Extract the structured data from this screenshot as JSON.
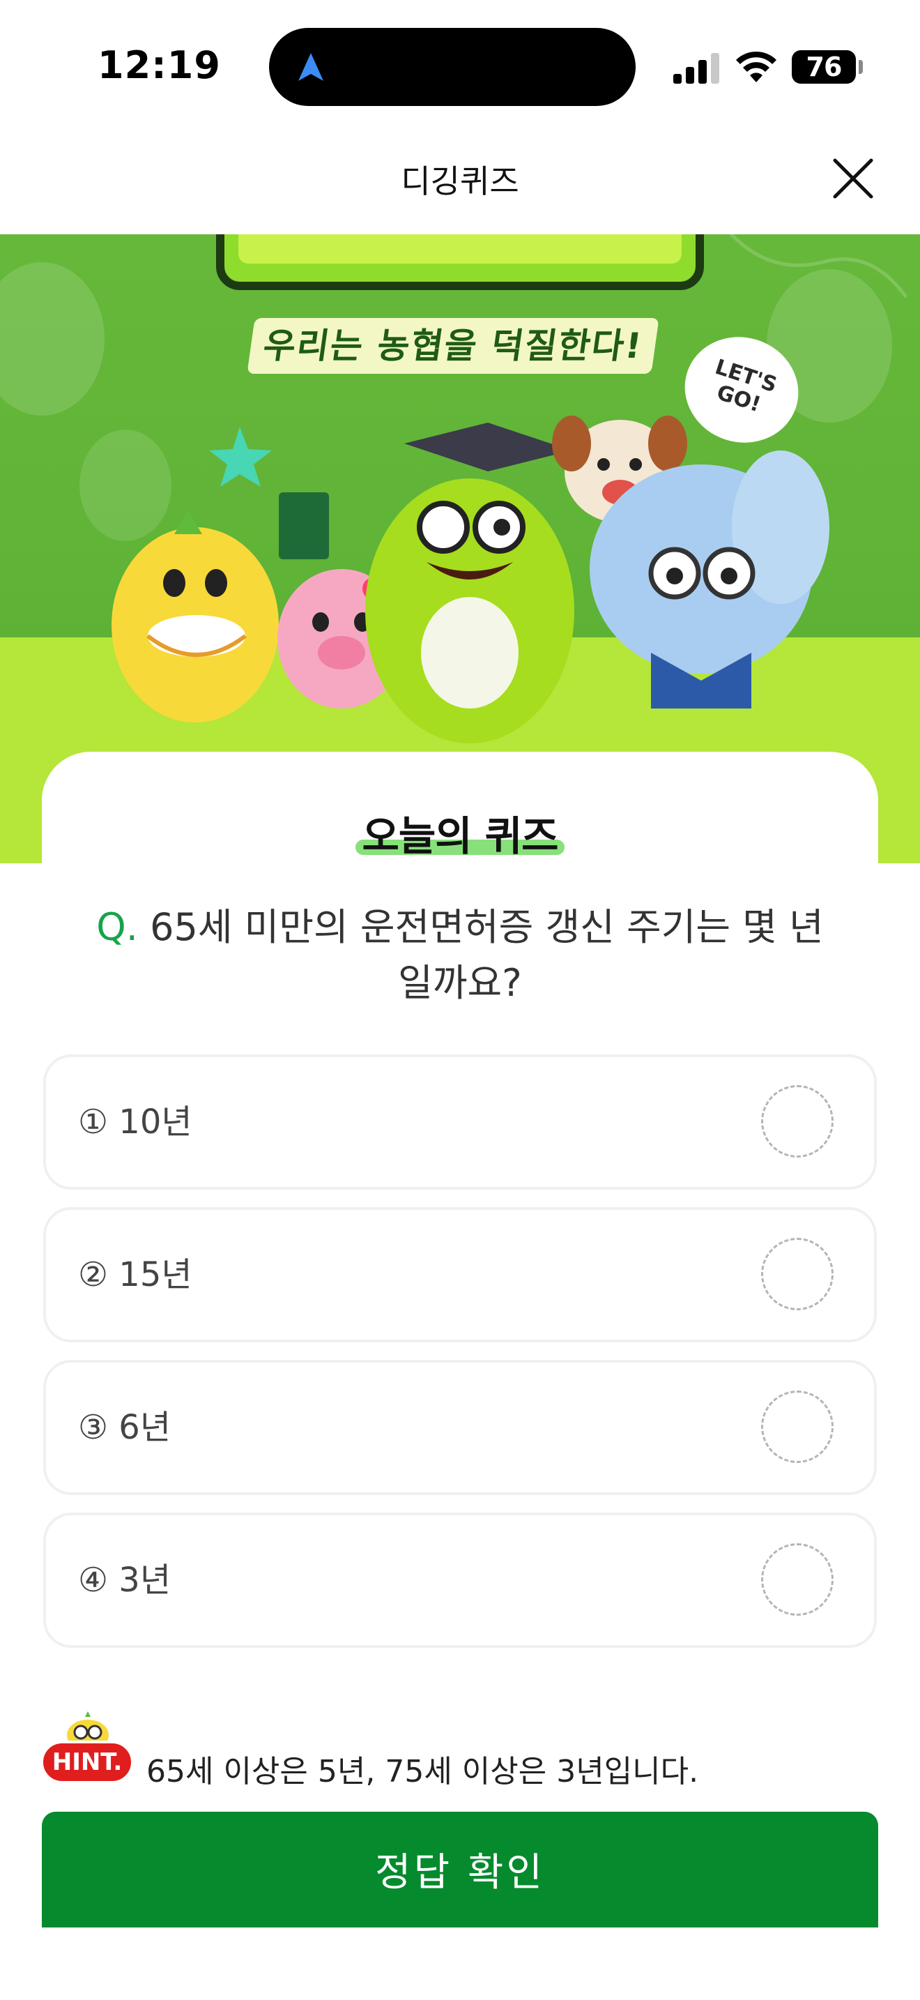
{
  "status_bar": {
    "time": "12:19",
    "battery": "76"
  },
  "header": {
    "title": "디깅퀴즈"
  },
  "banner": {
    "subtitle": "우리는 농협을 덕질한다!",
    "speech": "LET'S GO!"
  },
  "quiz": {
    "title": "오늘의 퀴즈",
    "question_prefix": "Q.",
    "question": "65세 미만의 운전면허증 갱신 주기는 몇 년일까요?",
    "options": [
      {
        "label": "① 10년"
      },
      {
        "label": "② 15년"
      },
      {
        "label": "③ 6년"
      },
      {
        "label": "④ 3년"
      }
    ]
  },
  "hint": {
    "badge": "HINT.",
    "text": "65세 이상은 5년, 75세 이상은 3년입니다."
  },
  "submit": {
    "label": "정답 확인"
  },
  "colors": {
    "accent_green": "#058a2e",
    "question_prefix_green": "#17a34a",
    "banner_green": "#5fb336",
    "banner_floor": "#b5e63a",
    "hint_red": "#e01e1e"
  }
}
